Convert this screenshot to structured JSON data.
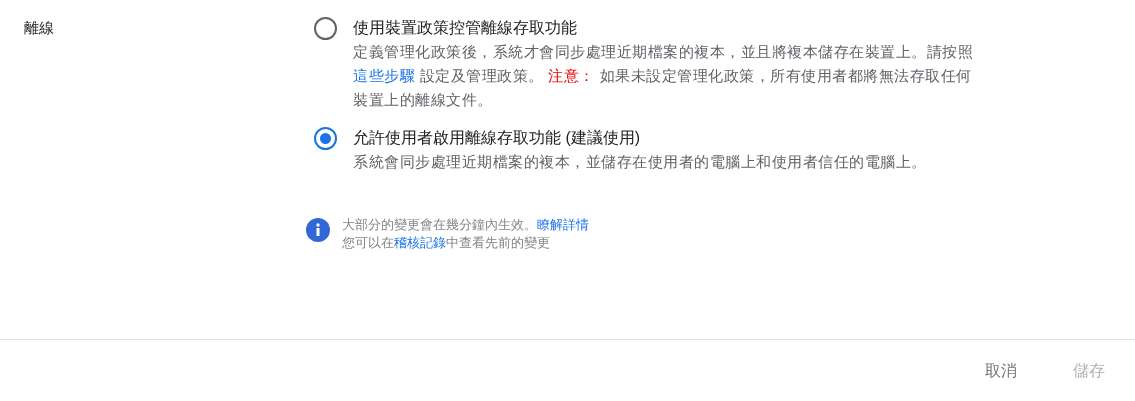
{
  "section": {
    "label": "離線"
  },
  "options": [
    {
      "title": "使用裝置政策控管離線存取功能",
      "selected": false,
      "description": [
        {
          "kind": "text",
          "text": "定義管理化政策後，系統才會同步處理近期檔案的複本，並且將複本儲存在裝置上。請按照 "
        },
        {
          "kind": "link",
          "text": "這些步驟"
        },
        {
          "kind": "text",
          "text": " 設定及管理政策。 "
        },
        {
          "kind": "warning",
          "text": "注意："
        },
        {
          "kind": "text",
          "text": " 如果未設定管理化政策，所有使用者都將無法存取任何裝置上的離線文件。"
        }
      ]
    },
    {
      "title": "允許使用者啟用離線存取功能 (建議使用)",
      "selected": true,
      "description": [
        {
          "kind": "text",
          "text": "系統會同步處理近期檔案的複本，並儲存在使用者的電腦上和使用者信任的電腦上。"
        }
      ]
    }
  ],
  "notice": {
    "lines": [
      [
        {
          "kind": "text",
          "text": "大部分的變更會在幾分鐘內生效。"
        },
        {
          "kind": "link",
          "text": "瞭解詳情"
        }
      ],
      [
        {
          "kind": "text",
          "text": "您可以在"
        },
        {
          "kind": "link",
          "text": "稽核記錄"
        },
        {
          "kind": "text",
          "text": "中查看先前的變更"
        }
      ]
    ]
  },
  "buttons": [
    {
      "label": "取消",
      "disabled": false
    },
    {
      "label": "儲存",
      "disabled": true
    }
  ]
}
